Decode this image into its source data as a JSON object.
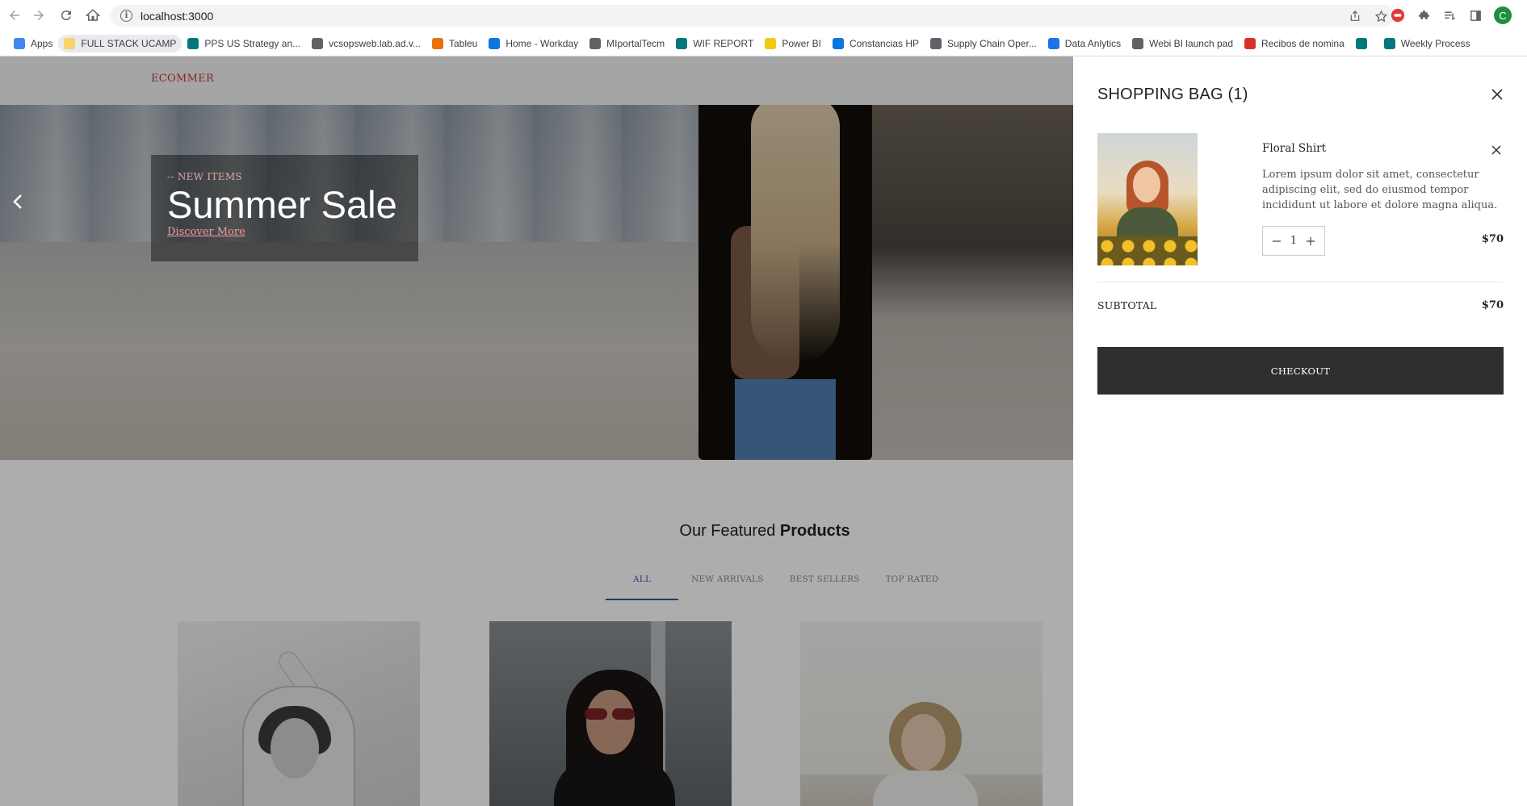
{
  "browser": {
    "url": "localhost:3000",
    "avatar_letter": "C",
    "bookmarks": [
      {
        "label": "Apps",
        "color": "#4285f4"
      },
      {
        "label": "FULL STACK UCAMP",
        "color": "#f9d26b"
      },
      {
        "label": "PPS US Strategy an...",
        "color": "#03787c"
      },
      {
        "label": "vcsopsweb.lab.ad.v...",
        "color": "#5f6368"
      },
      {
        "label": "Tableu",
        "color": "#e8710a"
      },
      {
        "label": "Home - Workday",
        "color": "#0875e1"
      },
      {
        "label": "MIportalTecm",
        "color": "#5f6368"
      },
      {
        "label": "WIF REPORT",
        "color": "#03787c"
      },
      {
        "label": "Power BI",
        "color": "#f2c811"
      },
      {
        "label": "Constancias HP",
        "color": "#0875e1"
      },
      {
        "label": "Supply Chain Oper...",
        "color": "#5f6368"
      },
      {
        "label": "Data Anlytics",
        "color": "#1a73e8"
      },
      {
        "label": "Webi BI launch pad",
        "color": "#5f6368"
      },
      {
        "label": "Recibos de nomina",
        "color": "#d93025"
      },
      {
        "label": "",
        "color": "#03787c"
      },
      {
        "label": "Weekly Process",
        "color": "#03787c"
      }
    ]
  },
  "site": {
    "logo": "ECOMMER",
    "hero": {
      "tag": "-- NEW ITEMS",
      "title": "Summer Sale",
      "link": "Discover More"
    },
    "featured": {
      "title_regular": "Our Featured ",
      "title_bold": "Products",
      "tabs": [
        "ALL",
        "NEW ARRIVALS",
        "BEST SELLERS",
        "TOP RATED"
      ],
      "active_tab": "ALL"
    }
  },
  "cart": {
    "title": "SHOPPING BAG (1)",
    "items": [
      {
        "name": "Floral Shirt",
        "description": "Lorem ipsum dolor sit amet, consectetur adipiscing elit, sed do eiusmod tempor incididunt ut labore et dolore magna aliqua.",
        "quantity": "1",
        "price": "$70"
      }
    ],
    "subtotal_label": "SUBTOTAL",
    "subtotal_value": "$70",
    "checkout_label": "CHECKOUT"
  },
  "colors": {
    "accent": "#2c5aa0",
    "logo": "#c0392b",
    "checkout_bg": "#2f2f2f"
  }
}
